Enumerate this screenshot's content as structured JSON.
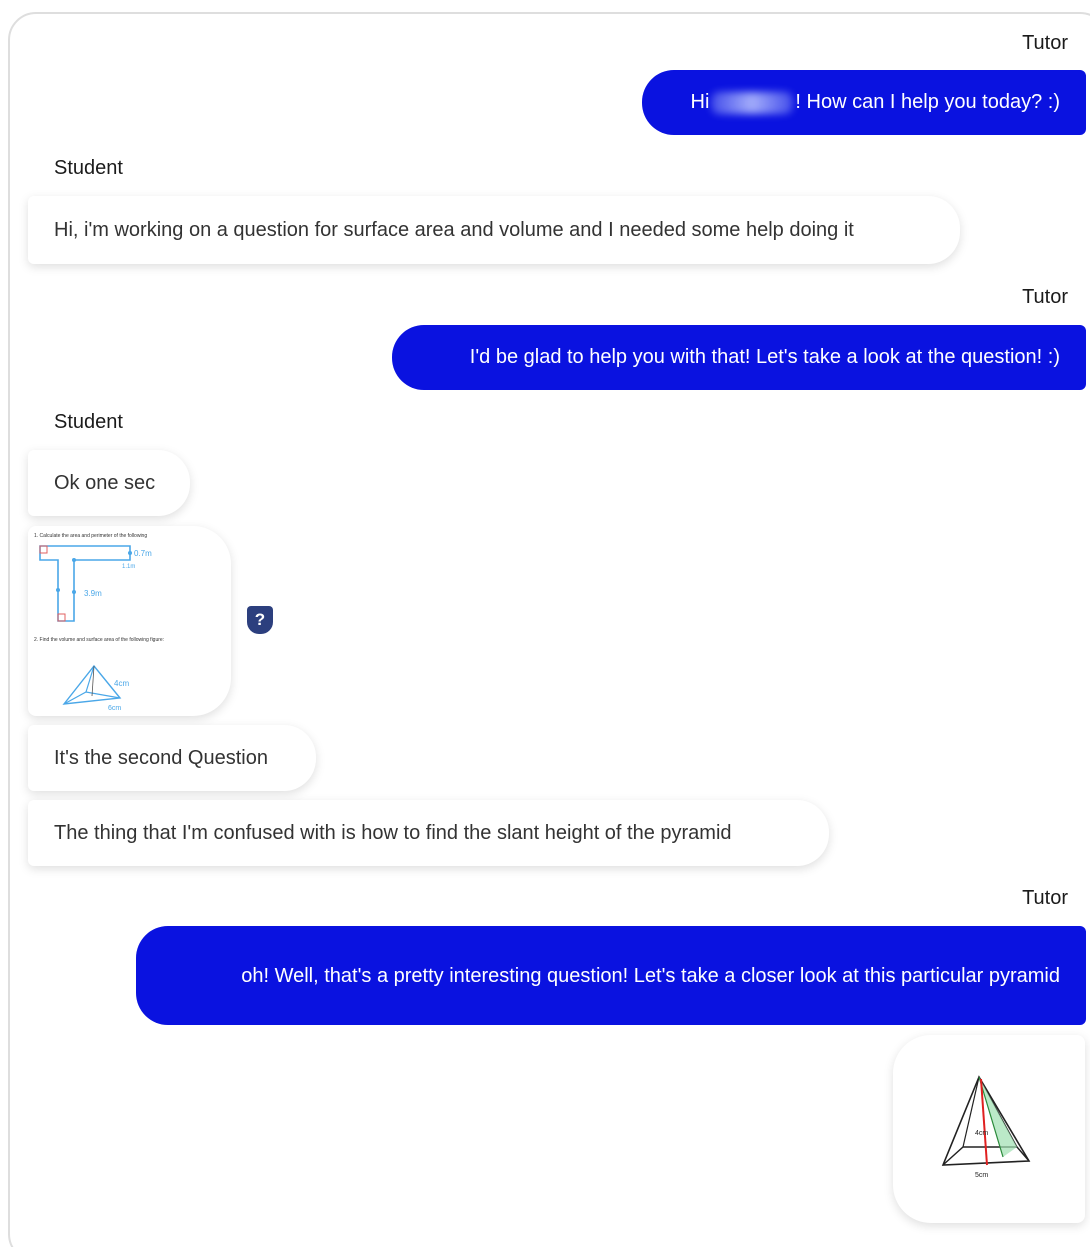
{
  "speakers": {
    "tutor": "Tutor",
    "student": "Student"
  },
  "messages": {
    "m1_hi": "Hi",
    "m1_rest": "! How can I help you today? :)",
    "m2": "Hi, i'm working on a question for surface area and volume and I needed some help doing it",
    "m3": "I'd be glad to help you with that! Let's take a look at the question! :)",
    "m4": "Ok one sec",
    "m5": "It's the second Question",
    "m6": "The thing that I'm confused with is how to find the slant height of the pyramid",
    "m7": "oh! Well, that's a pretty interesting question! Let's take a closer look at this particular pyramid"
  },
  "worksheet": {
    "q1": "1.   Calculate the area and perimeter of the following",
    "q2": "2.   Find the volume and surface area of the following figure:",
    "dim_a": "0.7m",
    "dim_b": "1.1m",
    "dim_c": "3.9m",
    "dim_d": "4cm",
    "dim_e": "6cm"
  },
  "sketch": {
    "height_label": "4cm",
    "base_label": "5cm"
  },
  "help_badge": "?",
  "colors": {
    "tutor_bubble": "#0a12e0",
    "badge": "#2c3f7e"
  }
}
